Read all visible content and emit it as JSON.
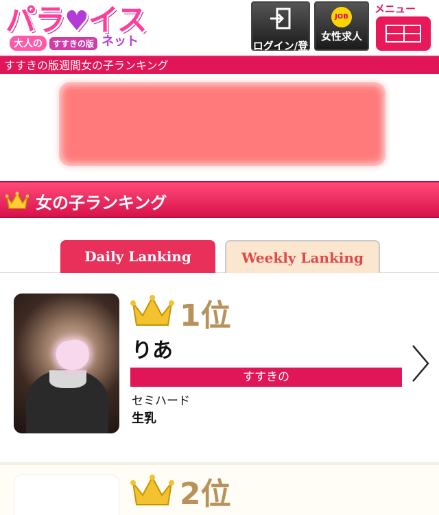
{
  "header": {
    "logo_main": "パラ",
    "logo_heart": "♥",
    "logo_main2": "イス",
    "logo_sub_adult": "大人の",
    "logo_sub_area": "すすきの版",
    "logo_sub_net": "ネット",
    "login_label": "ログイン/登録",
    "job_badge": "JOB",
    "job_label": "女性求人",
    "menu_label": "メニュー"
  },
  "titlebar": {
    "text": "すすきの版週間女の子ランキング"
  },
  "ranking": {
    "title": "女の子ランキング",
    "tabs": [
      {
        "label": "Daily Lanking"
      },
      {
        "label": "Weekly Lanking"
      }
    ],
    "items": [
      {
        "rank": "1位",
        "name": "りあ",
        "area": "すすきの",
        "type": "セミハード",
        "option": "生乳"
      },
      {
        "rank": "2位"
      }
    ]
  },
  "colors": {
    "accent": "#e01658",
    "gold": "#b8925a",
    "weekly_tab_bg": "#fbe6d0"
  }
}
